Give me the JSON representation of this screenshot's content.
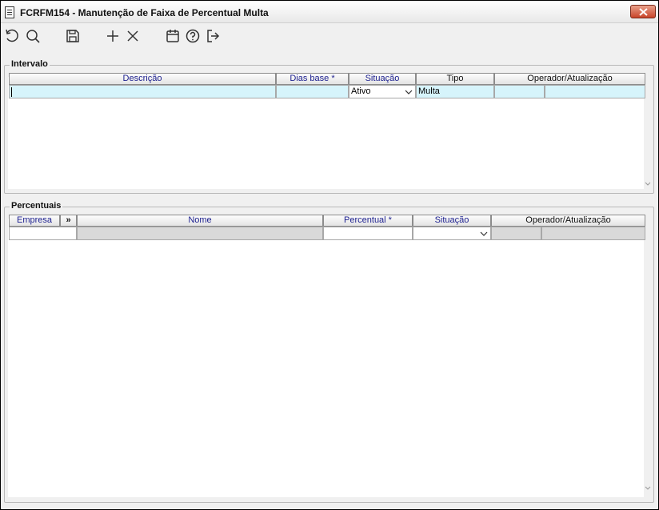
{
  "window": {
    "title": "FCRFM154 - Manutenção de Faixa de Percentual Multa"
  },
  "toolbar": {
    "buttons": [
      "undo-icon",
      "search-icon",
      "save-icon",
      "add-icon",
      "delete-icon",
      "calendar-icon",
      "help-icon",
      "exit-icon"
    ]
  },
  "intervalo": {
    "label": "Intervalo",
    "columns": {
      "descricao": "Descrição",
      "dias_base": "Dias base *",
      "situacao": "Situação",
      "tipo": "Tipo",
      "operador": "Operador/Atualização"
    },
    "row": {
      "descricao": "",
      "dias_base": "",
      "situacao": "Ativo",
      "tipo": "Multa",
      "operador": "",
      "atualizacao": ""
    }
  },
  "percentuais": {
    "label": "Percentuais",
    "columns": {
      "empresa": "Empresa",
      "expand": "»",
      "nome": "Nome",
      "percentual": "Percentual *",
      "situacao": "Situação",
      "operador": "Operador/Atualização"
    },
    "row": {
      "empresa": "",
      "nome": "",
      "percentual": "",
      "situacao": "",
      "operador": "",
      "atualizacao": ""
    }
  },
  "colors": {
    "header_blue": "#1c1f8f",
    "cell_cyan": "#d6f4fb",
    "cell_gray": "#d9d9d9",
    "close_red": "#c9452a"
  }
}
